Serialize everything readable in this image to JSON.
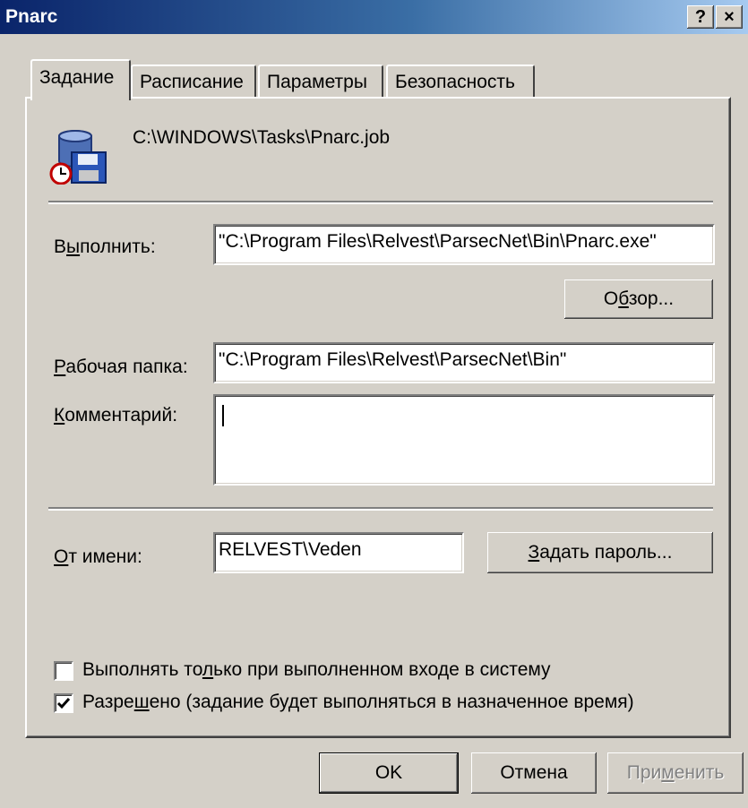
{
  "window": {
    "title": "Pnarc",
    "help_label": "?",
    "close_label": "×"
  },
  "tabs": [
    {
      "label": "Задание",
      "active": true
    },
    {
      "label": "Расписание",
      "active": false
    },
    {
      "label": "Параметры",
      "active": false
    },
    {
      "label": "Безопасность",
      "active": false
    }
  ],
  "task": {
    "path": "C:\\WINDOWS\\Tasks\\Pnarc.job",
    "icon": "scheduled-task-icon"
  },
  "run": {
    "label_pre": "В",
    "label_acc": "ы",
    "label_post": "полнить:",
    "value": "\"C:\\Program Files\\Relvest\\ParsecNet\\Bin\\Pnarc.exe\""
  },
  "browse": {
    "label_pre": "О",
    "label_acc": "б",
    "label_post": "зор..."
  },
  "workdir": {
    "label_acc": "Р",
    "label_post": "абочая папка:",
    "value": "\"C:\\Program Files\\Relvest\\ParsecNet\\Bin\""
  },
  "comment": {
    "label_acc": "К",
    "label_post": "омментарий:",
    "value": ""
  },
  "runas": {
    "label_acc": "О",
    "label_post": "т имени:",
    "value": "RELVEST\\Veden"
  },
  "set_password": {
    "label_acc": "З",
    "label_post": "адать пароль..."
  },
  "only_logged_on": {
    "label_pre": "Выполнять то",
    "label_acc": "л",
    "label_post": "ько при выполненном входе в систему",
    "checked": false
  },
  "enabled": {
    "label_pre": "Разре",
    "label_acc": "ш",
    "label_post": "ено (задание будет выполняться в назначенное время)",
    "checked": true
  },
  "buttons": {
    "ok": "OK",
    "cancel": "Отмена",
    "apply_pre": "При",
    "apply_acc": "м",
    "apply_post": "енить"
  },
  "colors": {
    "titlebar_start": "#0a246a",
    "titlebar_end": "#a6caf0",
    "face": "#d4d0c8"
  }
}
